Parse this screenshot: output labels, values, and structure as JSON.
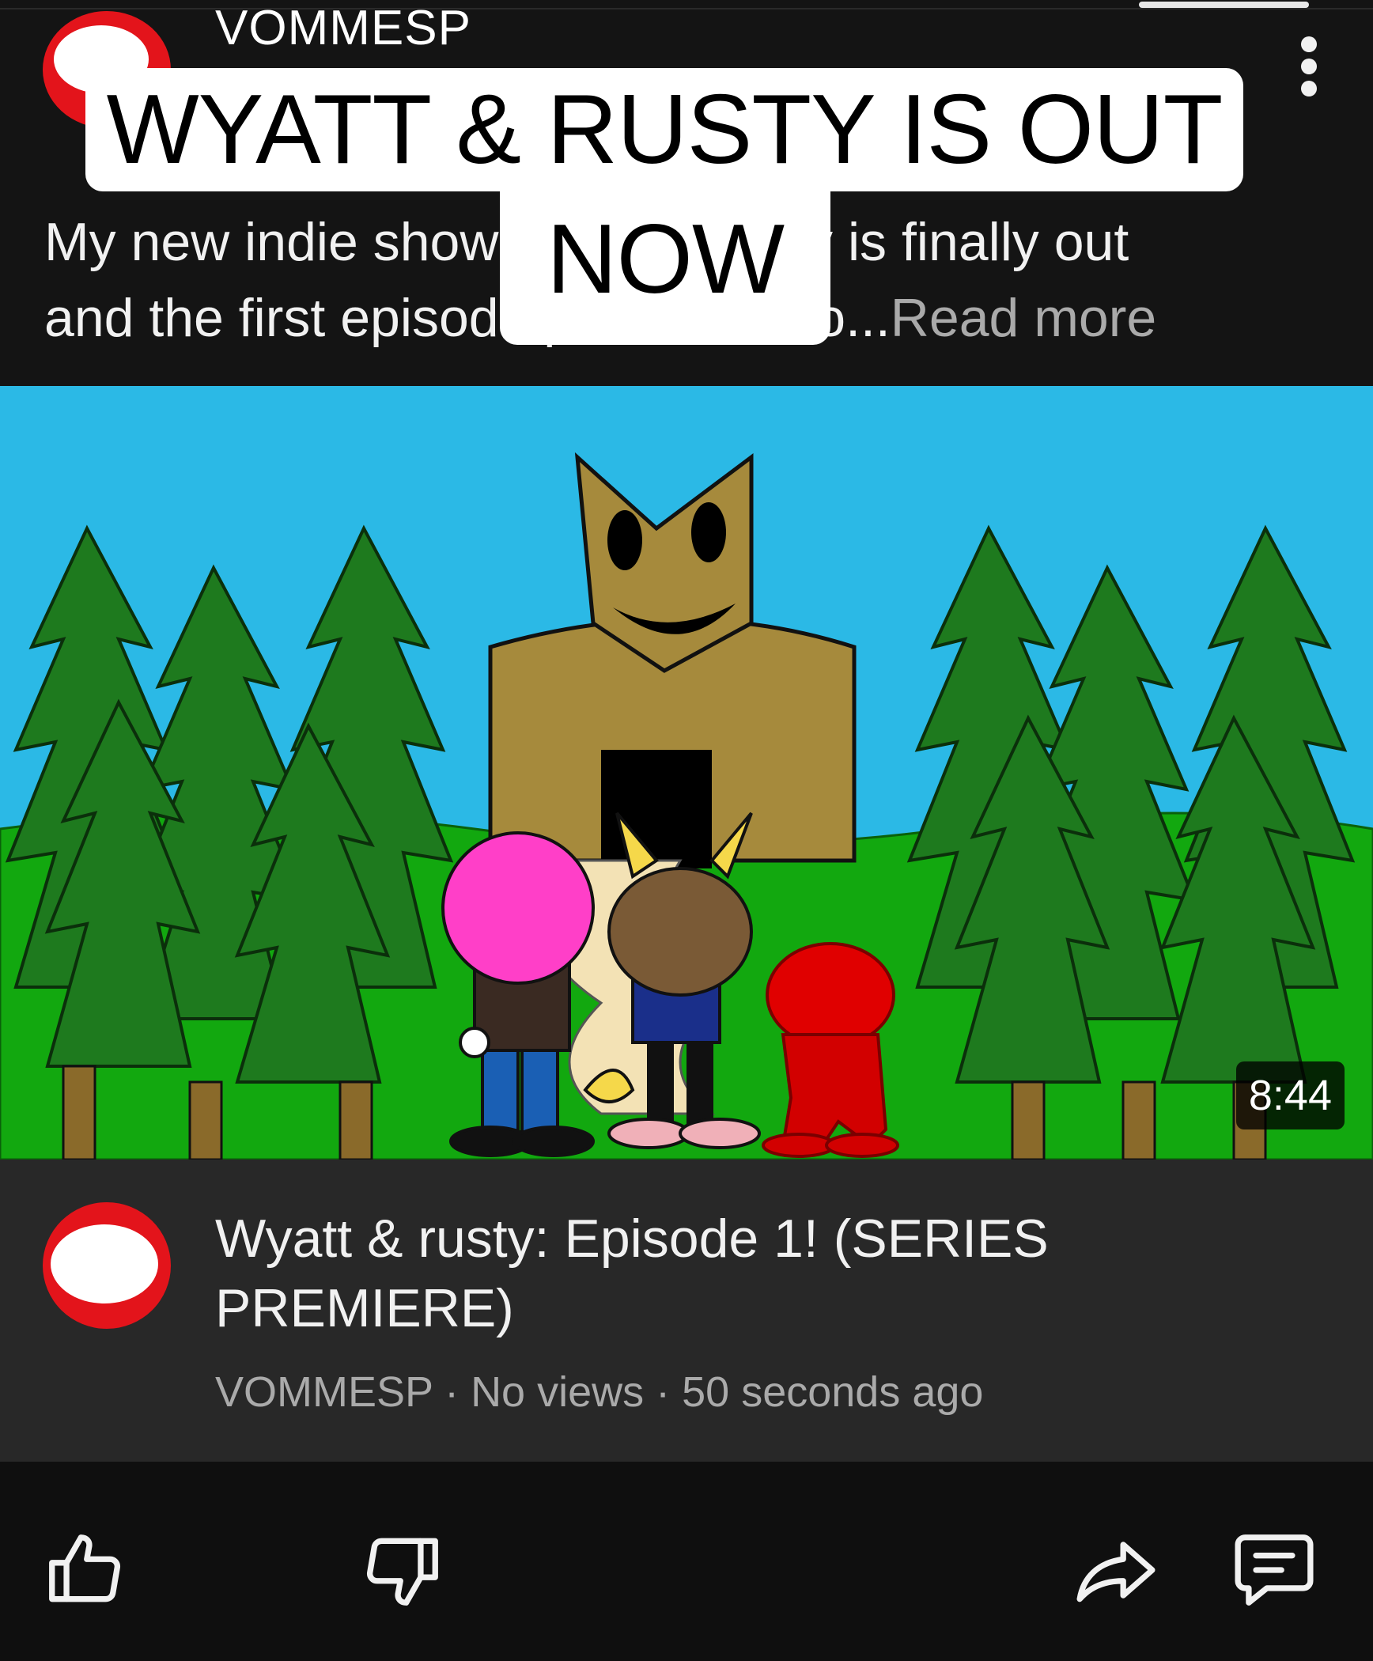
{
  "header": {
    "channel_name": "VOMMESP",
    "overlay_line1": "WYATT & RUSTY IS OUT",
    "overlay_line2": "NOW",
    "description_line1": "My new indie show Wyatt & rusty is finally out",
    "description_line2": "and the first episode premiere! Yo...",
    "read_more": "Read more"
  },
  "video": {
    "duration": "8:44",
    "title_line1": "Wyatt & rusty: Episode 1! (SERIES",
    "title_line2": "PREMIERE)",
    "channel": "VOMMESP",
    "sep1": " · ",
    "views": "No views",
    "sep2": " · ",
    "age": "50 seconds ago"
  },
  "actions": {
    "like_icon": "thumbs-up-icon",
    "dislike_icon": "thumbs-down-icon",
    "share_icon": "share-icon",
    "comments_icon": "comments-icon"
  },
  "colors": {
    "avatar_red": "#e3141b",
    "sky": "#2bb9e6",
    "grass": "#12a80f",
    "tree": "#1e7a1e",
    "monster": "#a68a3c"
  }
}
